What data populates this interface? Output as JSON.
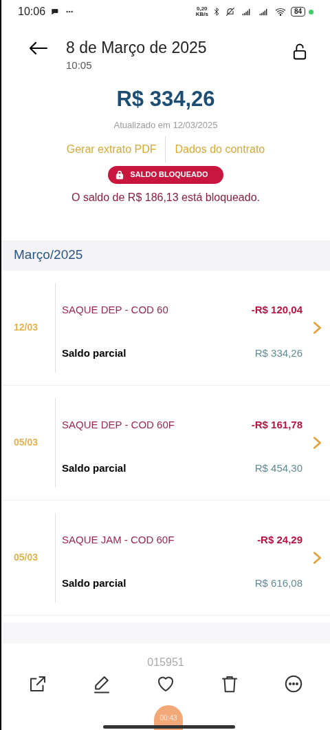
{
  "status_bar": {
    "time": "10:06",
    "speed": "0,20",
    "speed_unit": "KB/s",
    "battery": "84"
  },
  "header": {
    "title": "8 de Março de 2025",
    "time": "10:05"
  },
  "balance": {
    "amount": "R$ 334,26",
    "updated": "Atualizado em 12/03/2025",
    "links": [
      "Gerar extrato PDF",
      "Dados do contrato"
    ],
    "badge": "SALDO BLOQUEADO",
    "blocked_note": "O saldo de R$ 186,13 está bloqueado."
  },
  "month": "Março/2025",
  "transactions": [
    {
      "date": "12/03",
      "description": "SAQUE DEP - COD 60",
      "amount": "-R$ 120,04",
      "partial_label": "Saldo parcial",
      "partial": "R$ 334,26"
    },
    {
      "date": "05/03",
      "description": "SAQUE DEP - COD 60F",
      "amount": "-R$ 161,78",
      "partial_label": "Saldo parcial",
      "partial": "R$ 454,30"
    },
    {
      "date": "05/03",
      "description": "SAQUE JAM - COD 60F",
      "amount": "-R$ 24,29",
      "partial_label": "Saldo parcial",
      "partial": "R$ 616,08"
    }
  ],
  "footer_code": "015951",
  "toolbar": [
    {
      "kind": "share"
    },
    {
      "kind": "edit"
    },
    {
      "kind": "favorite"
    },
    {
      "kind": "delete"
    },
    {
      "kind": "more"
    }
  ],
  "recording": "00:43"
}
